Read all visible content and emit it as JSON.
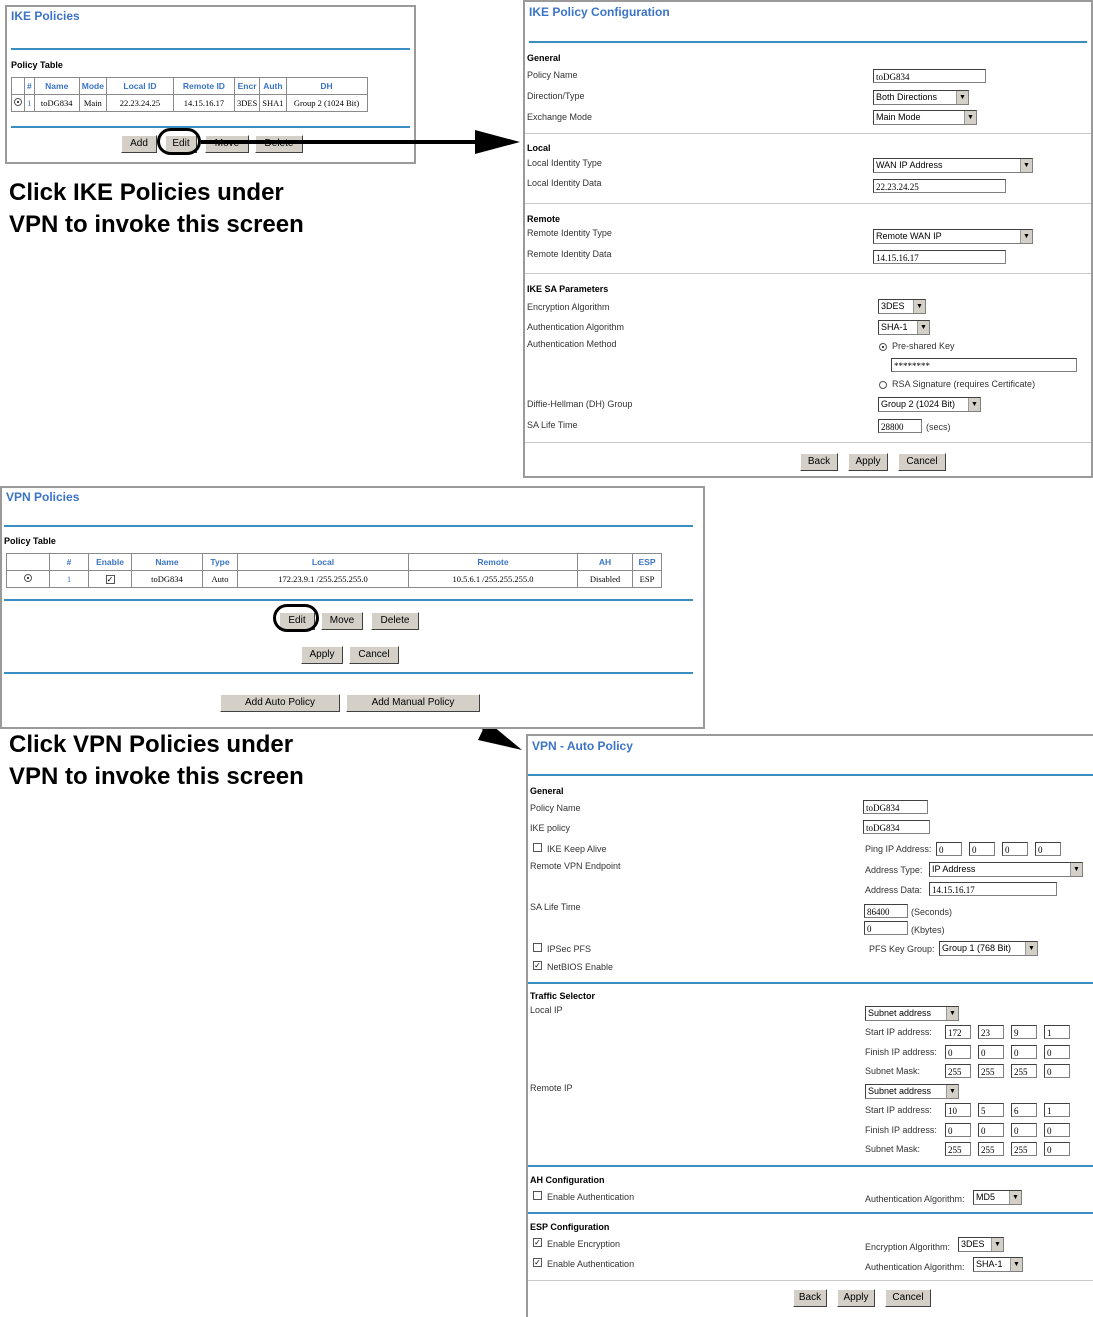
{
  "ike_policies": {
    "title": "IKE Policies",
    "table_title": "Policy Table",
    "headers": [
      "",
      "#",
      "Name",
      "Mode",
      "Local ID",
      "Remote ID",
      "Encr",
      "Auth",
      "DH"
    ],
    "row": {
      "num": "1",
      "name": "toDG834",
      "mode": "Main",
      "local_id": "22.23.24.25",
      "remote_id": "14.15.16.17",
      "encr": "3DES",
      "auth": "SHA1",
      "dh": "Group 2 (1024 Bit)"
    },
    "buttons": {
      "add": "Add",
      "edit": "Edit",
      "move": "Move",
      "delete": "Delete"
    }
  },
  "caption1": {
    "line1": "Click IKE Policies under",
    "line2": "VPN to invoke this screen"
  },
  "ike_config": {
    "title": "IKE Policy Configuration",
    "general": {
      "heading": "General",
      "policy_name_label": "Policy Name",
      "policy_name": "toDG834",
      "direction_label": "Direction/Type",
      "direction": "Both Directions",
      "exchange_label": "Exchange Mode",
      "exchange": "Main Mode"
    },
    "local": {
      "heading": "Local",
      "type_label": "Local Identity Type",
      "type": "WAN IP Address",
      "data_label": "Local Identity Data",
      "data": "22.23.24.25"
    },
    "remote": {
      "heading": "Remote",
      "type_label": "Remote Identity Type",
      "type": "Remote WAN IP",
      "data_label": "Remote Identity Data",
      "data": "14.15.16.17"
    },
    "ike_sa": {
      "heading": "IKE SA Parameters",
      "enc_label": "Encryption Algorithm",
      "enc": "3DES",
      "auth_label": "Authentication Algorithm",
      "auth": "SHA-1",
      "method_label": "Authentication Method",
      "psk_label": "Pre-shared Key",
      "psk_value": "********",
      "rsa_label": "RSA Signature (requires Certificate)",
      "dh_label": "Diffie-Hellman (DH) Group",
      "dh": "Group 2 (1024 Bit)",
      "life_label": "SA Life Time",
      "life": "28800",
      "life_unit": "(secs)"
    },
    "buttons": {
      "back": "Back",
      "apply": "Apply",
      "cancel": "Cancel"
    }
  },
  "vpn_policies": {
    "title": "VPN Policies",
    "table_title": "Policy Table",
    "headers": [
      "",
      "#",
      "Enable",
      "Name",
      "Type",
      "Local",
      "Remote",
      "AH",
      "ESP"
    ],
    "row": {
      "num": "1",
      "enable_mark": "✓",
      "name": "toDG834",
      "type": "Auto",
      "local": "172.23.9.1 /255.255.255.0",
      "remote": "10.5.6.1 /255.255.255.0",
      "ah": "Disabled",
      "esp": "ESP"
    },
    "buttons": {
      "edit": "Edit",
      "move": "Move",
      "delete": "Delete",
      "apply": "Apply",
      "cancel": "Cancel",
      "add_auto": "Add Auto Policy",
      "add_manual": "Add Manual Policy"
    }
  },
  "caption2": {
    "line1": "Click VPN Policies under",
    "line2": "VPN to invoke this screen"
  },
  "auto_policy": {
    "title": "VPN - Auto Policy",
    "general": {
      "heading": "General",
      "policy_name_label": "Policy Name",
      "policy_name": "toDG834",
      "ike_policy_label": "IKE policy",
      "ike_policy": "toDG834",
      "keepalive_label": "IKE Keep Alive",
      "ping_label": "Ping IP Address:",
      "ping": [
        "0",
        "0",
        "0",
        "0"
      ],
      "endpoint_label": "Remote VPN Endpoint",
      "addr_type_label": "Address Type:",
      "addr_type": "IP Address",
      "addr_data_label": "Address Data:",
      "addr_data": "14.15.16.17",
      "life_label": "SA Life Time",
      "life_sec": "86400",
      "life_sec_unit": "(Seconds)",
      "life_kb": "0",
      "life_kb_unit": "(Kbytes)",
      "pfs_label": "IPSec PFS",
      "pfs_group_label": "PFS Key Group:",
      "pfs_group": "Group 1 (768 Bit)",
      "netbios_label": "NetBIOS Enable",
      "netbios_mark": "✓"
    },
    "traffic": {
      "heading": "Traffic Selector",
      "local_label": "Local IP",
      "local_type": "Subnet address",
      "start_label": "Start IP address:",
      "local_start": [
        "172",
        "23",
        "9",
        "1"
      ],
      "finish_label": "Finish IP address:",
      "finish_ip": [
        "0",
        "0",
        "0",
        "0"
      ],
      "mask_label": "Subnet Mask:",
      "mask": [
        "255",
        "255",
        "255",
        "0"
      ],
      "remote_label": "Remote IP",
      "remote_type": "Subnet address",
      "remote_start": [
        "10",
        "5",
        "6",
        "1"
      ]
    },
    "ah": {
      "heading": "AH Configuration",
      "enable_label": "Enable Authentication",
      "alg_label": "Authentication Algorithm:",
      "alg": "MD5"
    },
    "esp": {
      "heading": "ESP Configuration",
      "enc_label": "Enable Encryption",
      "enc_mark": "✓",
      "enc_alg_label": "Encryption Algorithm:",
      "enc_alg": "3DES",
      "auth_label": "Enable Authentication",
      "auth_mark": "✓",
      "auth_alg_label": "Authentication Algorithm:",
      "auth_alg": "SHA-1"
    },
    "buttons": {
      "back": "Back",
      "apply": "Apply",
      "cancel": "Cancel"
    }
  }
}
